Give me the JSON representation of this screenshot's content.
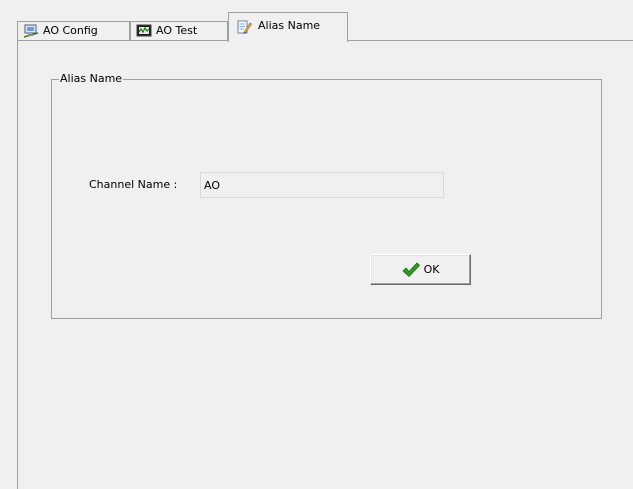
{
  "tabs": [
    {
      "label": "AO Config",
      "icon": "network-config-icon"
    },
    {
      "label": "AO Test",
      "icon": "waveform-monitor-icon"
    },
    {
      "label": "Alias Name",
      "icon": "notepad-pencil-icon",
      "active": true
    }
  ],
  "group": {
    "title": "Alias Name"
  },
  "channel_name": {
    "label": "Channel Name :",
    "value": "AO"
  },
  "ok_button": {
    "label": "OK",
    "icon": "checkmark-icon"
  },
  "colors": {
    "background": "#f0f0f0",
    "border": "#a0a0a0",
    "check_green": "#2e9c1f"
  }
}
